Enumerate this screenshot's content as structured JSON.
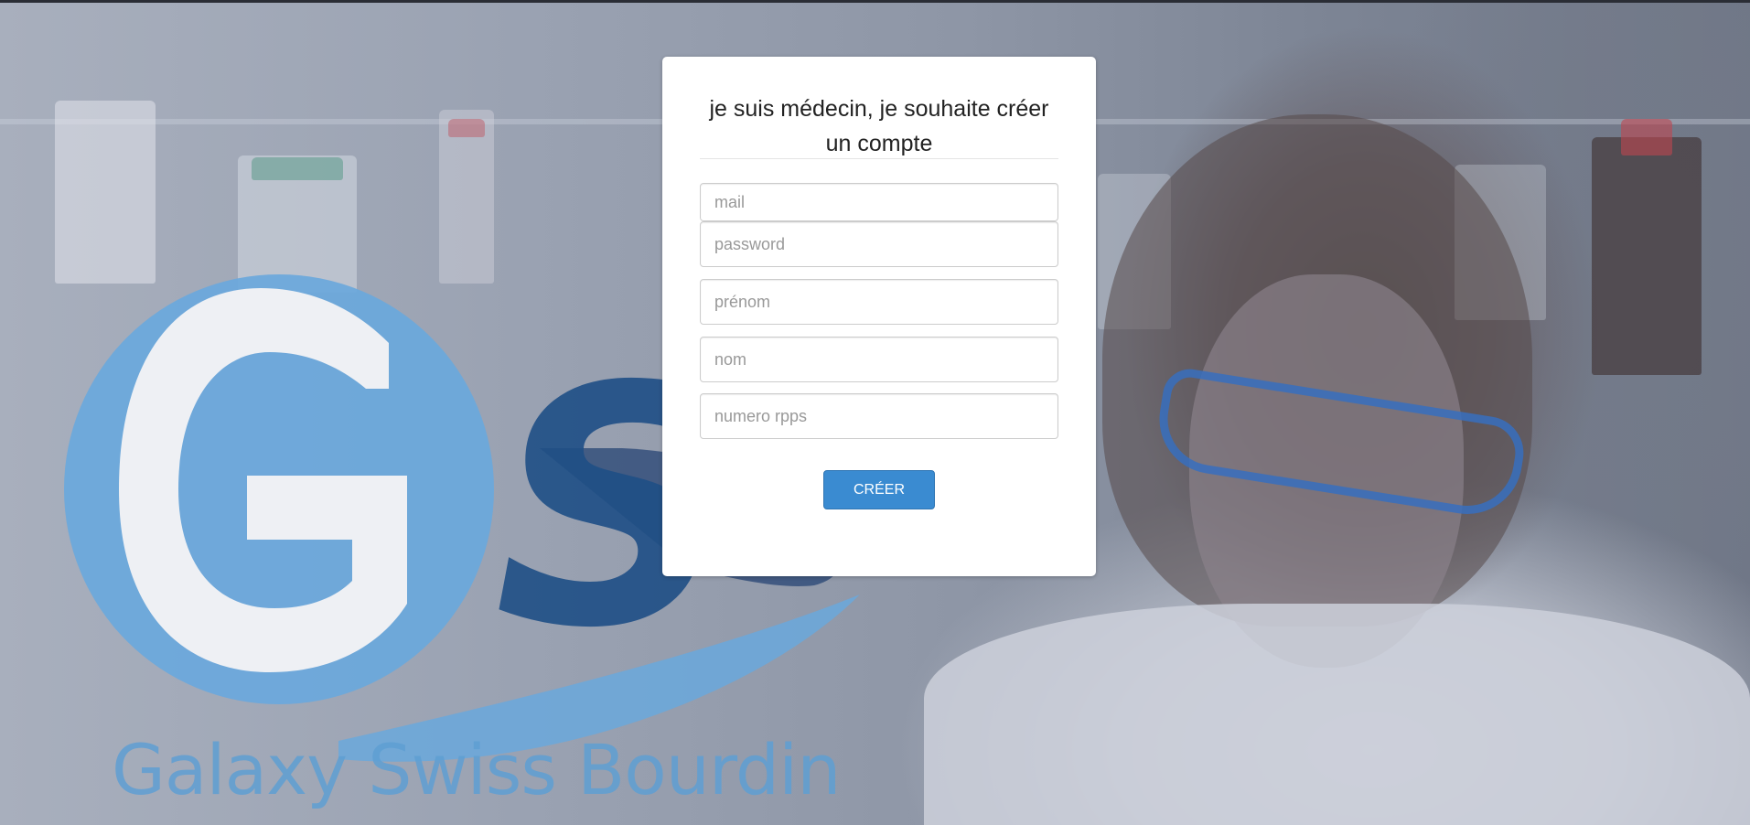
{
  "form": {
    "title": "je suis médecin, je souhaite créer un compte",
    "fields": {
      "mail": {
        "placeholder": "mail",
        "value": ""
      },
      "password": {
        "placeholder": "password",
        "value": ""
      },
      "prenom": {
        "placeholder": "prénom",
        "value": ""
      },
      "nom": {
        "placeholder": "nom",
        "value": ""
      },
      "rpps": {
        "placeholder": "numero rpps",
        "value": ""
      }
    },
    "submit_label": "CRÉER"
  },
  "branding": {
    "logo_letters": "GSB",
    "company_name": "Galaxy Swiss Bourdin"
  },
  "colors": {
    "accent": "#3a8bd1",
    "logo_light_blue": "#6aa8dc",
    "logo_dark_blue": "#1f4f86",
    "card_background": "#ffffff"
  },
  "icons": {
    "logo": "gsb-logo-icon"
  }
}
